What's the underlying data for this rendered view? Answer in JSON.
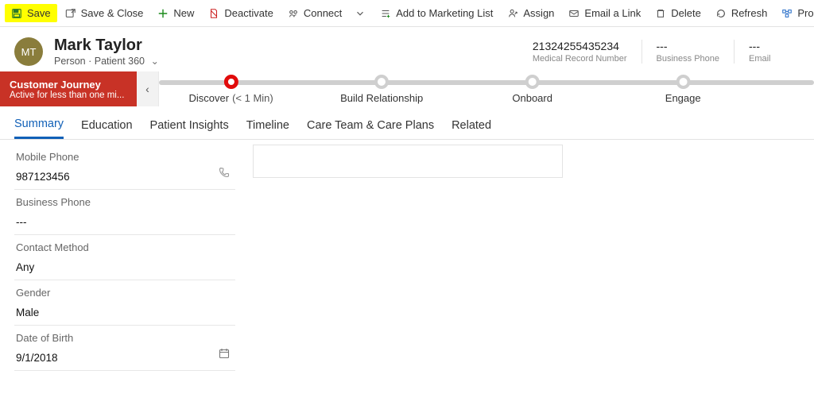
{
  "commands": {
    "save": "Save",
    "save_close": "Save & Close",
    "new": "New",
    "deactivate": "Deactivate",
    "connect": "Connect",
    "add_marketing": "Add to Marketing List",
    "assign": "Assign",
    "email_link": "Email a Link",
    "delete": "Delete",
    "refresh": "Refresh",
    "process": "Process"
  },
  "record": {
    "initials": "MT",
    "name": "Mark Taylor",
    "entity": "Person",
    "form": "Patient 360"
  },
  "header_fields": [
    {
      "value": "21324255435234",
      "label": "Medical Record Number"
    },
    {
      "value": "---",
      "label": "Business Phone"
    },
    {
      "value": "---",
      "label": "Email"
    }
  ],
  "journey": {
    "title": "Customer Journey",
    "subtitle": "Active for less than one mi...",
    "back": "‹",
    "stages": [
      {
        "label": "Discover",
        "time": "(< 1 Min)",
        "active": true,
        "pos": 11
      },
      {
        "label": "Build Relationship",
        "time": "",
        "active": false,
        "pos": 34
      },
      {
        "label": "Onboard",
        "time": "",
        "active": false,
        "pos": 57
      },
      {
        "label": "Engage",
        "time": "",
        "active": false,
        "pos": 80
      }
    ]
  },
  "tabs": [
    {
      "label": "Summary",
      "active": true
    },
    {
      "label": "Education",
      "active": false
    },
    {
      "label": "Patient Insights",
      "active": false
    },
    {
      "label": "Timeline",
      "active": false
    },
    {
      "label": "Care Team & Care Plans",
      "active": false
    },
    {
      "label": "Related",
      "active": false
    }
  ],
  "fields": {
    "mobile_phone": {
      "label": "Mobile Phone",
      "value": "987123456"
    },
    "business_phone": {
      "label": "Business Phone",
      "value": "---"
    },
    "contact_method": {
      "label": "Contact Method",
      "value": "Any"
    },
    "gender": {
      "label": "Gender",
      "value": "Male"
    },
    "dob": {
      "label": "Date of Birth",
      "value": "9/1/2018"
    }
  }
}
